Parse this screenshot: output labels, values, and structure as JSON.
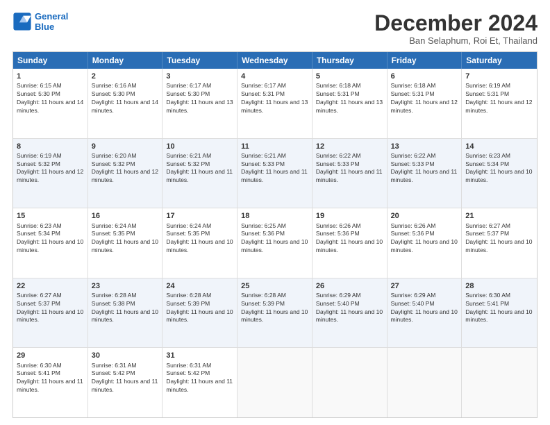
{
  "header": {
    "logo_line1": "General",
    "logo_line2": "Blue",
    "month_title": "December 2024",
    "location": "Ban Selaphum, Roi Et, Thailand"
  },
  "days_of_week": [
    "Sunday",
    "Monday",
    "Tuesday",
    "Wednesday",
    "Thursday",
    "Friday",
    "Saturday"
  ],
  "weeks": [
    [
      {
        "day": "1",
        "rise": "6:15 AM",
        "set": "5:30 PM",
        "daylight": "11 hours and 14 minutes."
      },
      {
        "day": "2",
        "rise": "6:16 AM",
        "set": "5:30 PM",
        "daylight": "11 hours and 14 minutes."
      },
      {
        "day": "3",
        "rise": "6:17 AM",
        "set": "5:30 PM",
        "daylight": "11 hours and 13 minutes."
      },
      {
        "day": "4",
        "rise": "6:17 AM",
        "set": "5:31 PM",
        "daylight": "11 hours and 13 minutes."
      },
      {
        "day": "5",
        "rise": "6:18 AM",
        "set": "5:31 PM",
        "daylight": "11 hours and 13 minutes."
      },
      {
        "day": "6",
        "rise": "6:18 AM",
        "set": "5:31 PM",
        "daylight": "11 hours and 12 minutes."
      },
      {
        "day": "7",
        "rise": "6:19 AM",
        "set": "5:31 PM",
        "daylight": "11 hours and 12 minutes."
      }
    ],
    [
      {
        "day": "8",
        "rise": "6:19 AM",
        "set": "5:32 PM",
        "daylight": "11 hours and 12 minutes."
      },
      {
        "day": "9",
        "rise": "6:20 AM",
        "set": "5:32 PM",
        "daylight": "11 hours and 12 minutes."
      },
      {
        "day": "10",
        "rise": "6:21 AM",
        "set": "5:32 PM",
        "daylight": "11 hours and 11 minutes."
      },
      {
        "day": "11",
        "rise": "6:21 AM",
        "set": "5:33 PM",
        "daylight": "11 hours and 11 minutes."
      },
      {
        "day": "12",
        "rise": "6:22 AM",
        "set": "5:33 PM",
        "daylight": "11 hours and 11 minutes."
      },
      {
        "day": "13",
        "rise": "6:22 AM",
        "set": "5:33 PM",
        "daylight": "11 hours and 11 minutes."
      },
      {
        "day": "14",
        "rise": "6:23 AM",
        "set": "5:34 PM",
        "daylight": "11 hours and 10 minutes."
      }
    ],
    [
      {
        "day": "15",
        "rise": "6:23 AM",
        "set": "5:34 PM",
        "daylight": "11 hours and 10 minutes."
      },
      {
        "day": "16",
        "rise": "6:24 AM",
        "set": "5:35 PM",
        "daylight": "11 hours and 10 minutes."
      },
      {
        "day": "17",
        "rise": "6:24 AM",
        "set": "5:35 PM",
        "daylight": "11 hours and 10 minutes."
      },
      {
        "day": "18",
        "rise": "6:25 AM",
        "set": "5:36 PM",
        "daylight": "11 hours and 10 minutes."
      },
      {
        "day": "19",
        "rise": "6:26 AM",
        "set": "5:36 PM",
        "daylight": "11 hours and 10 minutes."
      },
      {
        "day": "20",
        "rise": "6:26 AM",
        "set": "5:36 PM",
        "daylight": "11 hours and 10 minutes."
      },
      {
        "day": "21",
        "rise": "6:27 AM",
        "set": "5:37 PM",
        "daylight": "11 hours and 10 minutes."
      }
    ],
    [
      {
        "day": "22",
        "rise": "6:27 AM",
        "set": "5:37 PM",
        "daylight": "11 hours and 10 minutes."
      },
      {
        "day": "23",
        "rise": "6:28 AM",
        "set": "5:38 PM",
        "daylight": "11 hours and 10 minutes."
      },
      {
        "day": "24",
        "rise": "6:28 AM",
        "set": "5:39 PM",
        "daylight": "11 hours and 10 minutes."
      },
      {
        "day": "25",
        "rise": "6:28 AM",
        "set": "5:39 PM",
        "daylight": "11 hours and 10 minutes."
      },
      {
        "day": "26",
        "rise": "6:29 AM",
        "set": "5:40 PM",
        "daylight": "11 hours and 10 minutes."
      },
      {
        "day": "27",
        "rise": "6:29 AM",
        "set": "5:40 PM",
        "daylight": "11 hours and 10 minutes."
      },
      {
        "day": "28",
        "rise": "6:30 AM",
        "set": "5:41 PM",
        "daylight": "11 hours and 10 minutes."
      }
    ],
    [
      {
        "day": "29",
        "rise": "6:30 AM",
        "set": "5:41 PM",
        "daylight": "11 hours and 11 minutes."
      },
      {
        "day": "30",
        "rise": "6:31 AM",
        "set": "5:42 PM",
        "daylight": "11 hours and 11 minutes."
      },
      {
        "day": "31",
        "rise": "6:31 AM",
        "set": "5:42 PM",
        "daylight": "11 hours and 11 minutes."
      },
      null,
      null,
      null,
      null
    ]
  ]
}
